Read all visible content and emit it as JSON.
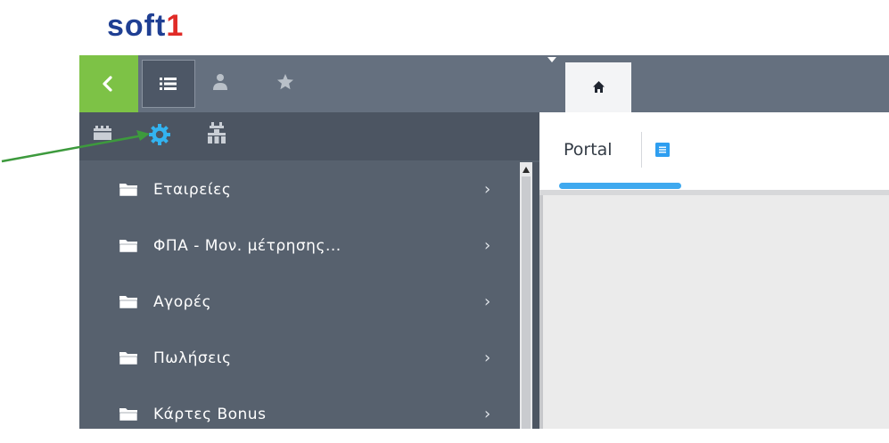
{
  "brand": {
    "name_main": "soft",
    "name_suffix": "1"
  },
  "header": {
    "home_tab_icon": "home-icon",
    "menu_icon": "list-icon",
    "user_icon": "user-icon",
    "favorites_icon": "star-icon",
    "collapse_icon": "chevron-left-icon"
  },
  "sidebar_toolbar": {
    "icons": [
      "modules-icon",
      "settings-icon",
      "tools-icon"
    ],
    "highlighted": "settings-icon"
  },
  "sidebar": {
    "items": [
      {
        "label": "Εταιρείες"
      },
      {
        "label": "ΦΠΑ - Μον. μέτρησης..."
      },
      {
        "label": "Αγορές"
      },
      {
        "label": "Πωλήσεις"
      },
      {
        "label": "Κάρτες Bonus"
      }
    ],
    "chevron": "›"
  },
  "main": {
    "tab_label": "Portal",
    "tab_menu_icon": "document-icon"
  },
  "colors": {
    "topbar": "#65707f",
    "sidebar": "#57616e",
    "accent_green": "#7dc246",
    "accent_blue": "#3fa9ef",
    "annotation_arrow": "#3d9a3d",
    "brand_blue": "#1f3f93",
    "brand_red": "#e02b27"
  }
}
